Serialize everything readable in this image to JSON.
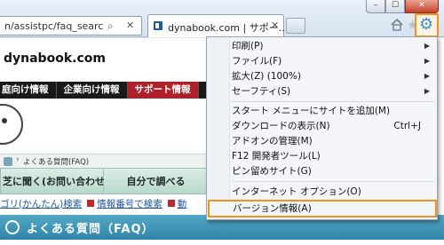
{
  "browser": {
    "address_text": "n/assistpc/faq_search,",
    "address_search_glyph": "⌕",
    "address_close_glyph": "✕",
    "tab_title": "dynabook.com | サポー...",
    "tab_close_glyph": "✕",
    "window_buttons": {
      "minimize": "–",
      "maximize": "☐",
      "close": "✕"
    },
    "star_glyph": "★",
    "gear_glyph": "⚙"
  },
  "page": {
    "site_name": "dynabook.com",
    "nav": [
      "庭向け情報",
      "企業向け情報",
      "サポート情報",
      "ショ"
    ],
    "breadcrumb_sep": "›",
    "breadcrumb": "よくある質問(FAQ)",
    "subtabs": [
      "芝に聞く(お問い合わせ)",
      "自分で調べる"
    ],
    "links": [
      "ゴリ(かんたん)検索",
      "情報番号で検索",
      "動"
    ],
    "faq_title": "よくある質問（FAQ）"
  },
  "menu": {
    "items": [
      {
        "label": "印刷(P)",
        "submenu": true
      },
      {
        "label": "ファイル(F)",
        "submenu": true
      },
      {
        "label": "拡大(Z) (100%)",
        "submenu": true
      },
      {
        "label": "セーフティ(S)",
        "submenu": true
      },
      {
        "label": "スタート メニューにサイトを追加(M)"
      },
      {
        "label": "ダウンロードの表示(N)",
        "shortcut": "Ctrl+J"
      },
      {
        "label": "アドオンの管理(M)"
      },
      {
        "label": "F12 開発者ツール(L)"
      },
      {
        "label": "ピン留めサイト(G)"
      },
      {
        "label": "インターネット オプション(O)"
      },
      {
        "label": "バージョン情報(A)"
      }
    ],
    "submenu_arrow": "▶"
  },
  "colors": {
    "highlight_outline": "#f39222",
    "active_nav": "#b0202a",
    "faq_bar": "#3d94b6"
  }
}
